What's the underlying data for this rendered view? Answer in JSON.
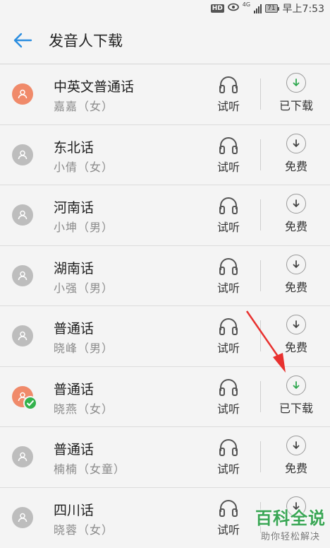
{
  "status_bar": {
    "hd": "HD",
    "network": "4G",
    "battery": "71",
    "time": "早上7:53"
  },
  "header": {
    "title": "发音人下载",
    "back_icon": "arrow-left-icon"
  },
  "colors": {
    "accent_blue": "#2a8de0",
    "download_green": "#2fa84f",
    "avatar_orange": "#f08a6a",
    "avatar_grey": "#bdbdbd",
    "arrow_red": "#e8312f"
  },
  "voices": [
    {
      "name": "中英文普通话",
      "speaker": "嘉嘉（女）",
      "listen_label": "试听",
      "action_label": "已下载",
      "downloaded": true,
      "avatar": "orange",
      "checked": false
    },
    {
      "name": "东北话",
      "speaker": "小倩（女）",
      "listen_label": "试听",
      "action_label": "免费",
      "downloaded": false,
      "avatar": "grey",
      "checked": false
    },
    {
      "name": "河南话",
      "speaker": "小坤（男）",
      "listen_label": "试听",
      "action_label": "免费",
      "downloaded": false,
      "avatar": "grey",
      "checked": false
    },
    {
      "name": "湖南话",
      "speaker": "小强（男）",
      "listen_label": "试听",
      "action_label": "免费",
      "downloaded": false,
      "avatar": "grey",
      "checked": false
    },
    {
      "name": "普通话",
      "speaker": "晓峰（男）",
      "listen_label": "试听",
      "action_label": "免费",
      "downloaded": false,
      "avatar": "grey",
      "checked": false
    },
    {
      "name": "普通话",
      "speaker": "晓燕（女）",
      "listen_label": "试听",
      "action_label": "已下载",
      "downloaded": true,
      "avatar": "orange",
      "checked": true
    },
    {
      "name": "普通话",
      "speaker": "楠楠（女童）",
      "listen_label": "试听",
      "action_label": "免费",
      "downloaded": false,
      "avatar": "grey",
      "checked": false
    },
    {
      "name": "四川话",
      "speaker": "晓蓉（女）",
      "listen_label": "试听",
      "action_label": "",
      "downloaded": false,
      "avatar": "grey",
      "checked": false
    }
  ],
  "watermark": {
    "title": "百科全说",
    "subtitle": "助你轻松解决"
  }
}
